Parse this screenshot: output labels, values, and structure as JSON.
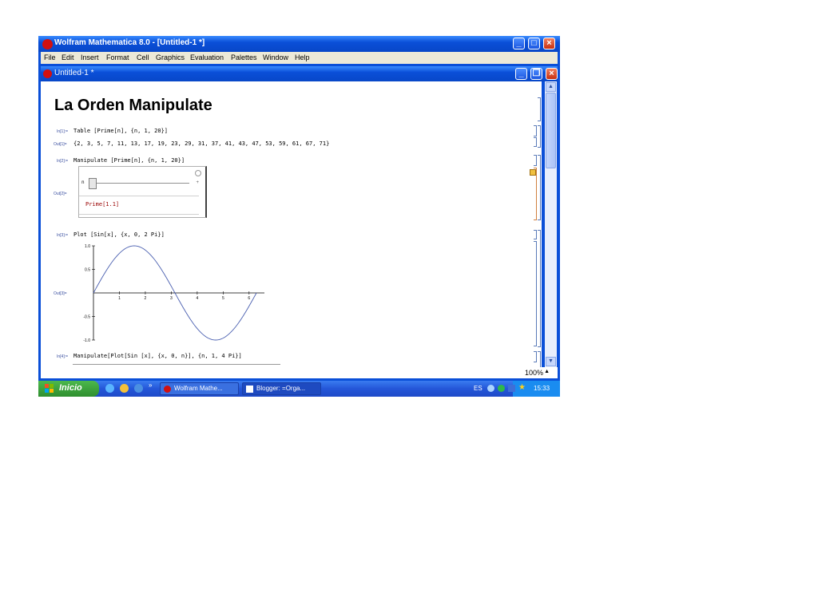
{
  "window": {
    "title": "Wolfram Mathematica 8.0 - [Untitled-1 *]",
    "menu": [
      "File",
      "Edit",
      "Insert",
      "Format",
      "Cell",
      "Graphics",
      "Evaluation",
      "Palettes",
      "Window",
      "Help"
    ]
  },
  "document": {
    "title": "Untitled-1 *",
    "heading": "La Orden Manipulate",
    "cells": {
      "in1_label": "In[1]:=",
      "in1_code": "Table [Prime[n], {n, 1, 20}]",
      "out1_label": "Out[1]=",
      "out1_value": "{2, 3, 5, 7, 11, 13, 17, 19, 23, 29, 31, 37, 41, 43, 47, 53, 59, 61, 67, 71}",
      "in2_label": "In[2]:=",
      "in2_code": "Manipulate [Prime[n], {n, 1, 20}]",
      "out2_label": "Out[2]=",
      "slider_var": "n",
      "manip_output": "Prime[1.1]",
      "in3_label": "In[3]:=",
      "in3_code": "Plot [Sin[x], {x, 0, 2 Pi}]",
      "out3_label": "Out[3]=",
      "in4_label": "In[4]:=",
      "in4_code": "Manipulate[Plot[Sin [x], {x, 0, n}], {n, 1, 4 Pi}]"
    }
  },
  "chart_data": {
    "type": "line",
    "function": "Sin[x]",
    "x": [
      0,
      0.5,
      1,
      1.5,
      2,
      2.5,
      3,
      3.5,
      4,
      4.5,
      5,
      5.5,
      6,
      6.283
    ],
    "y": [
      0,
      0.479,
      0.841,
      0.997,
      0.909,
      0.598,
      0.141,
      -0.351,
      -0.757,
      -0.978,
      -0.959,
      -0.706,
      -0.279,
      0
    ],
    "xlim": [
      0,
      6.283
    ],
    "ylim": [
      -1,
      1
    ],
    "x_ticks": [
      "1",
      "2",
      "3",
      "4",
      "5",
      "6"
    ],
    "y_ticks": [
      "1.0",
      "0.5",
      "-0.5",
      "-1.0"
    ],
    "line_color": "#4a5fb0"
  },
  "status": {
    "zoom": "100%"
  },
  "taskbar": {
    "start": "Inicio",
    "tasks": [
      "Wolfram Mathe...",
      "Blogger: =Orga..."
    ],
    "language": "ES",
    "clock": "15:33"
  }
}
